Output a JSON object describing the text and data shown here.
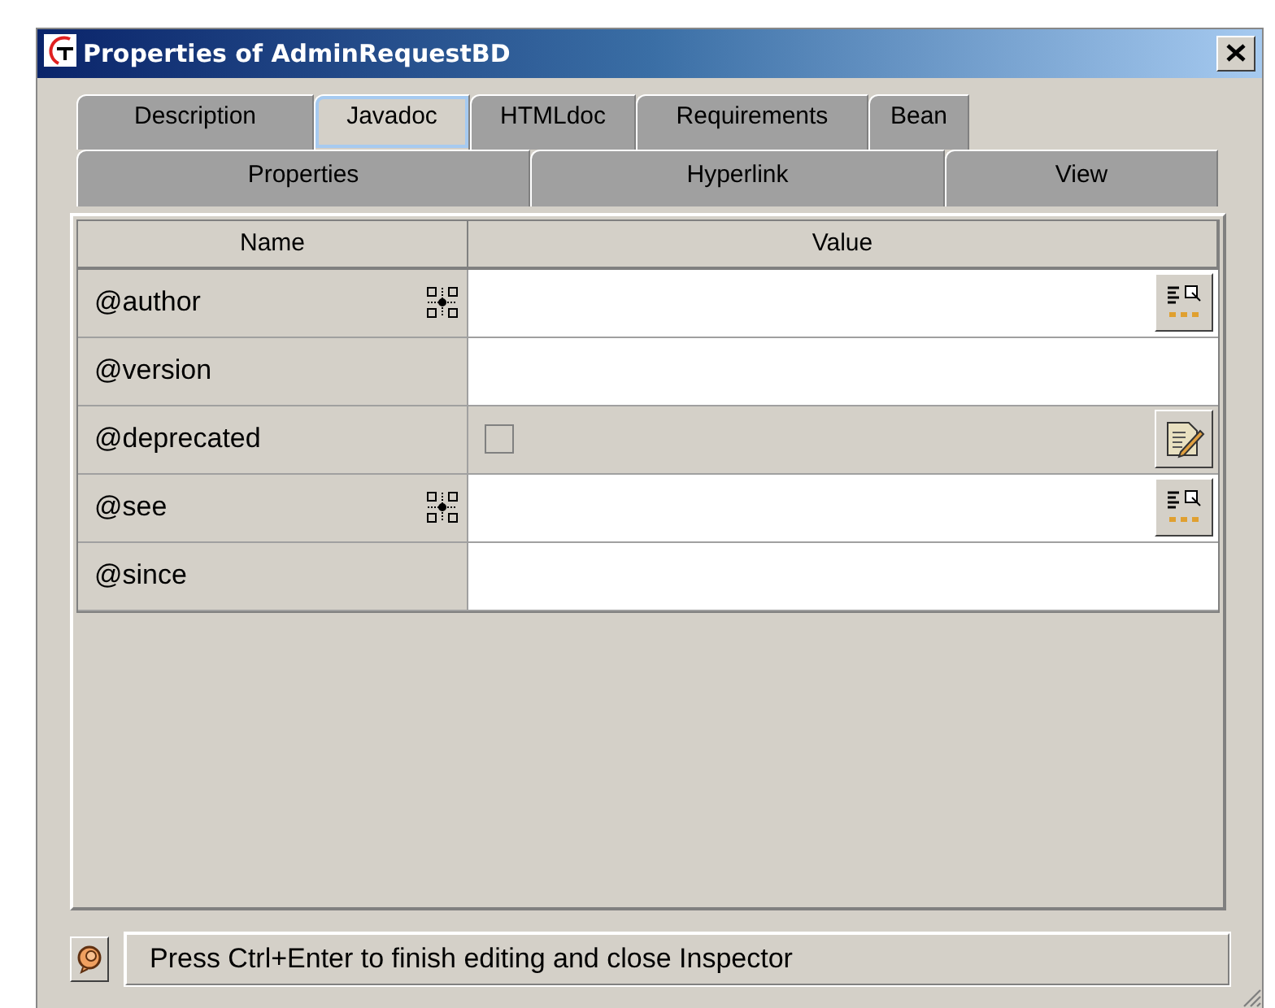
{
  "window": {
    "title": "Properties of AdminRequestBD"
  },
  "tab_rows": [
    [
      {
        "label": "Description",
        "selected": false
      },
      {
        "label": "Javadoc",
        "selected": true
      },
      {
        "label": "HTMLdoc",
        "selected": false
      },
      {
        "label": "Requirements",
        "selected": false
      },
      {
        "label": "Bean",
        "selected": false
      }
    ],
    [
      {
        "label": "Properties",
        "selected": false
      },
      {
        "label": "Hyperlink",
        "selected": false
      },
      {
        "label": "View",
        "selected": false
      }
    ]
  ],
  "table": {
    "columns": [
      "Name",
      "Value"
    ],
    "rows": [
      {
        "name": "@author",
        "multi": true,
        "kind": "text",
        "button": {
          "kind": "list"
        }
      },
      {
        "name": "@version",
        "multi": false,
        "kind": "text"
      },
      {
        "name": "@deprecated",
        "multi": false,
        "kind": "checkbox",
        "checked": false,
        "button": {
          "kind": "edit"
        }
      },
      {
        "name": "@see",
        "multi": true,
        "kind": "text",
        "button": {
          "kind": "list"
        }
      },
      {
        "name": "@since",
        "multi": false,
        "kind": "text"
      }
    ]
  },
  "status_bar": {
    "message": "Press Ctrl+Enter to finish editing and close Inspector"
  }
}
